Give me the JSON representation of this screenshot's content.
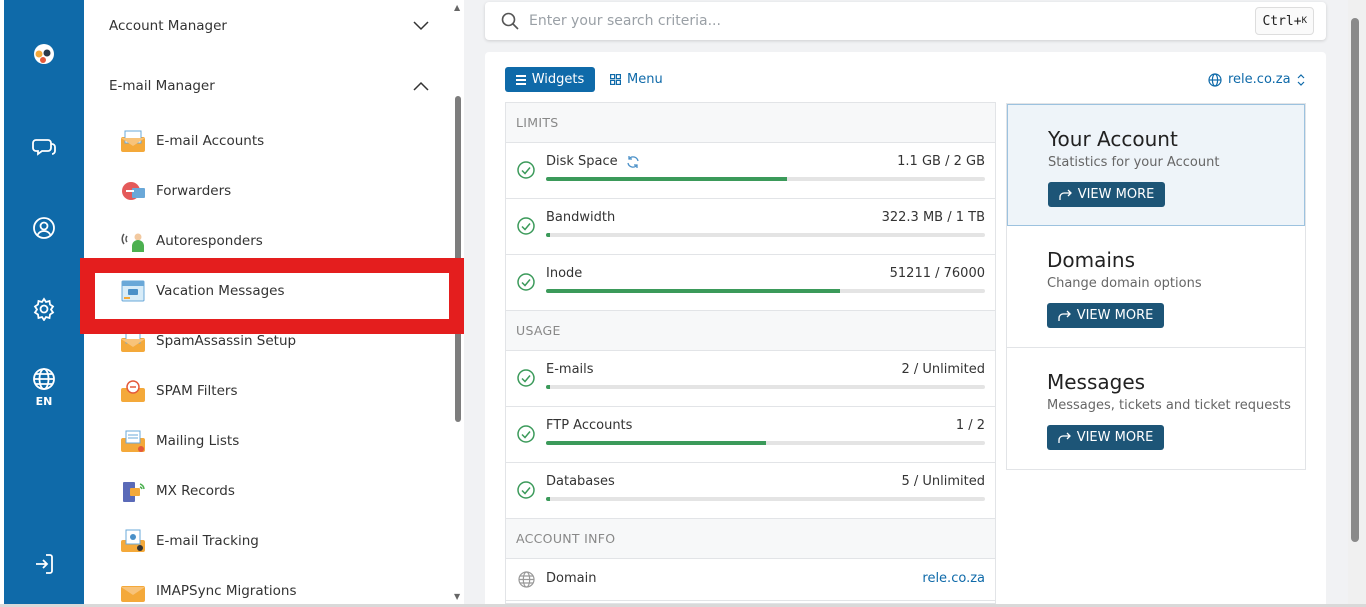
{
  "rail": {
    "items": [
      {
        "name": "logo-icon"
      },
      {
        "name": "chat-icon"
      },
      {
        "name": "user-icon"
      },
      {
        "name": "gear-icon"
      },
      {
        "name": "globe-icon",
        "label": "EN"
      },
      {
        "name": "logout-icon"
      }
    ]
  },
  "menu": {
    "account_manager": "Account Manager",
    "email_manager": "E-mail Manager",
    "items": [
      {
        "label": "E-mail Accounts"
      },
      {
        "label": "Forwarders"
      },
      {
        "label": "Autoresponders"
      },
      {
        "label": "Vacation Messages"
      },
      {
        "label": "SpamAssassin Setup"
      },
      {
        "label": "SPAM Filters"
      },
      {
        "label": "Mailing Lists"
      },
      {
        "label": "MX Records"
      },
      {
        "label": "E-mail Tracking"
      },
      {
        "label": "IMAPSync Migrations"
      }
    ]
  },
  "search": {
    "placeholder": "Enter your search criteria...",
    "shortcut": "Ctrl+",
    "shortcut_key": "K"
  },
  "toolbar": {
    "widgets_label": "Widgets",
    "menu_label": "Menu",
    "domain": "rele.co.za"
  },
  "stats": {
    "limits_header": "LIMITS",
    "usage_header": "USAGE",
    "account_header": "ACCOUNT INFO",
    "limits": [
      {
        "name": "Disk Space",
        "value": "1.1 GB / 2 GB",
        "fraction": 0.55
      },
      {
        "name": "Bandwidth",
        "value": "322.3 MB / 1 TB",
        "fraction": 0.01
      },
      {
        "name": "Inode",
        "value": "51211 / 76000",
        "fraction": 0.67
      }
    ],
    "usage": [
      {
        "name": "E-mails",
        "value": "2 / Unlimited",
        "fraction": 0.01
      },
      {
        "name": "FTP Accounts",
        "value": "1 / 2",
        "fraction": 0.5
      },
      {
        "name": "Databases",
        "value": "5 / Unlimited",
        "fraction": 0.01
      }
    ],
    "account": [
      {
        "name": "Domain",
        "value": "rele.co.za"
      }
    ]
  },
  "panels": [
    {
      "title": "Your Account",
      "subtitle": "Statistics for your Account",
      "button": "VIEW MORE"
    },
    {
      "title": "Domains",
      "subtitle": "Change domain options",
      "button": "VIEW MORE"
    },
    {
      "title": "Messages",
      "subtitle": "Messages, tickets and ticket requests",
      "button": "VIEW MORE"
    }
  ],
  "colors": {
    "brand": "#0f6aa9",
    "progress": "#3b9a5a",
    "highlight": "#e41e1e",
    "panel_button": "#1d5577"
  }
}
